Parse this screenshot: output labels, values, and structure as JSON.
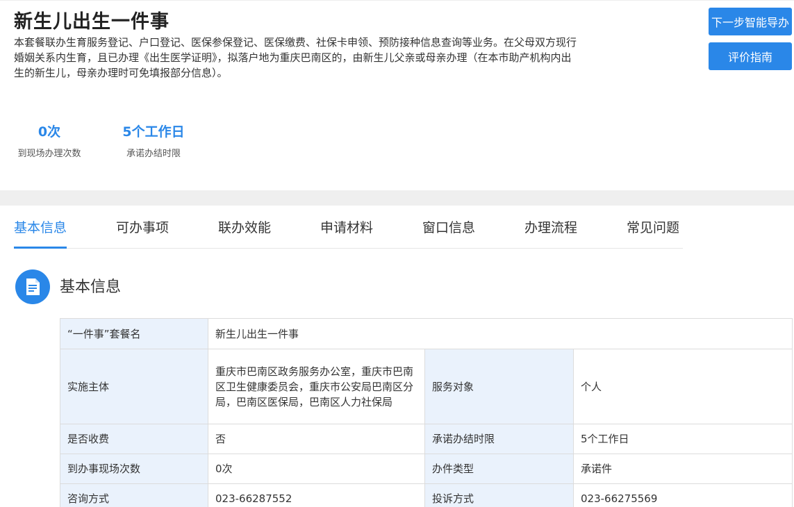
{
  "header": {
    "title": "新生儿出生一件事",
    "description": "本套餐联办生育服务登记、户口登记、医保参保登记、医保缴费、社保卡申领、预防接种信息查询等业务。在父母双方现行婚姻关系内生育，且已办理《出生医学证明》，拟落户地为重庆巴南区的，由新生儿父亲或母亲办理（在本市助产机构内出生的新生儿，母亲办理时可免填报部分信息）。"
  },
  "stats": [
    {
      "value": "0次",
      "label": "到现场办理次数"
    },
    {
      "value": "5个工作日",
      "label": "承诺办结时限"
    }
  ],
  "buttons": {
    "next_step": "下一步智能导办",
    "evaluation": "评价指南"
  },
  "tabs": [
    {
      "label": "基本信息",
      "active": true
    },
    {
      "label": "可办事项",
      "active": false
    },
    {
      "label": "联办效能",
      "active": false
    },
    {
      "label": "申请材料",
      "active": false
    },
    {
      "label": "窗口信息",
      "active": false
    },
    {
      "label": "办理流程",
      "active": false
    },
    {
      "label": "常见问题",
      "active": false
    }
  ],
  "section": {
    "title": "基本信息",
    "icon": "document-icon"
  },
  "info_table": {
    "package_name_label": "“一件事”套餐名",
    "package_name_value": "新生儿出生一件事",
    "implementer_label": "实施主体",
    "implementer_value": "重庆市巴南区政务服务办公室，重庆市巴南区卫生健康委员会，重庆市公安局巴南区分局，巴南区医保局，巴南区人力社保局",
    "service_target_label": "服务对象",
    "service_target_value": "个人",
    "fee_label": "是否收费",
    "fee_value": "否",
    "deadline_label": "承诺办结时限",
    "deadline_value": "5个工作日",
    "visits_label": "到办事现场次数",
    "visits_value": "0次",
    "type_label": "办件类型",
    "type_value": "承诺件",
    "consult_label": "咨询方式",
    "consult_value": "023-66287552",
    "complaint_label": "投诉方式",
    "complaint_value": "023-66275569"
  },
  "colors": {
    "accent": "#2a87e8",
    "label_cell_bg": "#eaf2fc",
    "band": "#efefef"
  }
}
